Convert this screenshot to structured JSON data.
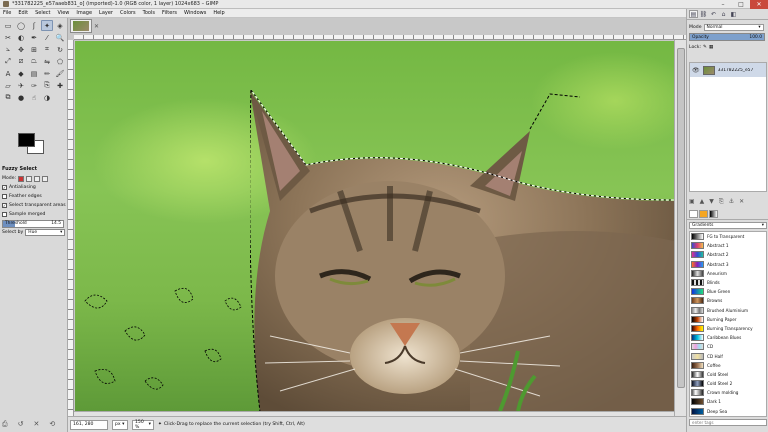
{
  "window": {
    "title": "*331782225_e57aaeb831_o] (imported)-1.0 (RGB color, 1 layer) 1024x683 – GIMP",
    "minimize": "–",
    "maximize": "□",
    "close": "✕"
  },
  "menu": [
    "File",
    "Edit",
    "Select",
    "View",
    "Image",
    "Layer",
    "Colors",
    "Tools",
    "Filters",
    "Windows",
    "Help"
  ],
  "toolbox": {
    "tools": [
      {
        "name": "rect-select-icon",
        "glyph": "▭"
      },
      {
        "name": "ellipse-select-icon",
        "glyph": "◯"
      },
      {
        "name": "free-select-icon",
        "glyph": "ʃ"
      },
      {
        "name": "fuzzy-select-icon",
        "glyph": "✦",
        "active": true
      },
      {
        "name": "color-select-icon",
        "glyph": "◈"
      },
      {
        "name": "scissors-icon",
        "glyph": "✂"
      },
      {
        "name": "foreground-select-icon",
        "glyph": "◐"
      },
      {
        "name": "paths-icon",
        "glyph": "✒"
      },
      {
        "name": "color-picker-icon",
        "glyph": "⁄"
      },
      {
        "name": "zoom-icon",
        "glyph": "🔍"
      },
      {
        "name": "measure-icon",
        "glyph": "⦣"
      },
      {
        "name": "move-icon",
        "glyph": "✥"
      },
      {
        "name": "align-icon",
        "glyph": "⊞"
      },
      {
        "name": "crop-icon",
        "glyph": "⌗"
      },
      {
        "name": "rotate-icon",
        "glyph": "↻"
      },
      {
        "name": "scale-icon",
        "glyph": "⤢"
      },
      {
        "name": "shear-icon",
        "glyph": "⧄"
      },
      {
        "name": "perspective-icon",
        "glyph": "⏢"
      },
      {
        "name": "flip-icon",
        "glyph": "⇋"
      },
      {
        "name": "cage-icon",
        "glyph": "⬠"
      },
      {
        "name": "text-icon",
        "glyph": "A"
      },
      {
        "name": "bucket-fill-icon",
        "glyph": "◆"
      },
      {
        "name": "blend-icon",
        "glyph": "▤"
      },
      {
        "name": "pencil-icon",
        "glyph": "✏"
      },
      {
        "name": "paintbrush-icon",
        "glyph": "🖌"
      },
      {
        "name": "eraser-icon",
        "glyph": "▱"
      },
      {
        "name": "airbrush-icon",
        "glyph": "✈"
      },
      {
        "name": "ink-icon",
        "glyph": "✑"
      },
      {
        "name": "clone-icon",
        "glyph": "⎘"
      },
      {
        "name": "heal-icon",
        "glyph": "✚"
      },
      {
        "name": "perspective-clone-icon",
        "glyph": "⧉"
      },
      {
        "name": "blur-icon",
        "glyph": "●"
      },
      {
        "name": "smudge-icon",
        "glyph": "☝"
      },
      {
        "name": "dodge-burn-icon",
        "glyph": "◑"
      }
    ],
    "options": {
      "title": "Fuzzy Select",
      "mode_label": "Mode:",
      "antialiasing": "Antialiasing",
      "feather_edges": "Feather edges",
      "select_transparent": "Select transparent areas",
      "sample_merged": "Sample merged",
      "threshold_label": "Threshold",
      "threshold_value": "14.5",
      "threshold_fraction": 0.2,
      "select_by_label": "Select by",
      "select_by_value": "Hue"
    },
    "bottom_glyphs": [
      "⎙",
      "↺",
      "✕",
      "⟲"
    ]
  },
  "canvas": {
    "image_tab_close": "✕"
  },
  "status": {
    "coords": "161, 280",
    "unit": "px",
    "zoom": "150 %",
    "message": "Click-Drag to replace the current selection (try Shift, Ctrl, Alt)"
  },
  "layers": {
    "mode_label": "Mode",
    "mode_value": "Normal",
    "opacity_label": "Opacity",
    "opacity_value": "100.0",
    "lock_label": "Lock:",
    "layer_name": "331782225_e57",
    "tabs": [
      "▤",
      "⛓",
      "↶",
      "⌂",
      "◧"
    ],
    "bottom_glyphs": [
      "▣",
      "▲",
      "▼",
      "⎘",
      "⚓",
      "✕"
    ]
  },
  "gradients": {
    "filter_label": "Gradients",
    "tag_placeholder": "enter tags",
    "items": [
      {
        "name": "FG to Transparent",
        "css": "linear-gradient(to right,#000,rgba(0,0,0,0))"
      },
      {
        "name": "Abstract 1",
        "css": "linear-gradient(to right,#3a4bd0,#e04070,#f0c050)"
      },
      {
        "name": "Abstract 2",
        "css": "linear-gradient(to right,#e03090,#3050d0,#20c0a0)"
      },
      {
        "name": "Abstract 3",
        "css": "linear-gradient(to right,#ff7020,#8020c0,#20a0f0)"
      },
      {
        "name": "Aneurism",
        "css": "linear-gradient(to right,#202020,#e0e0e0,#404040)"
      },
      {
        "name": "Blinds",
        "css": "repeating-linear-gradient(to right,#111 0,#111 2px,#ddd 2px,#ddd 4px)"
      },
      {
        "name": "Blue Green",
        "css": "linear-gradient(to right,#1030e0,#20e080)"
      },
      {
        "name": "Browns",
        "css": "linear-gradient(to right,#6b3b1a,#d09860,#4a2810)"
      },
      {
        "name": "Brushed Aluminium",
        "css": "linear-gradient(to right,#888,#eee,#777,#ddd)"
      },
      {
        "name": "Burning Paper",
        "css": "linear-gradient(to right,#000,#c04000,#fff)"
      },
      {
        "name": "Burning Transparency",
        "css": "linear-gradient(to right,#300,#f60,#ff0)"
      },
      {
        "name": "Caribbean Blues",
        "css": "linear-gradient(to right,#003080,#00c0e0,#fff)"
      },
      {
        "name": "CD",
        "css": "linear-gradient(to right,#ddd,#f0a0e0,#a0e0f0,#ddd)"
      },
      {
        "name": "CD Half",
        "css": "linear-gradient(to right,#ccc,#f0e0a0,#bbb)"
      },
      {
        "name": "Coffee",
        "css": "linear-gradient(to right,#3a2010,#9a7050,#f0e0c0)"
      },
      {
        "name": "Cold Steel",
        "css": "linear-gradient(to right,#222,#fff,#333)"
      },
      {
        "name": "Cold Steel 2",
        "css": "linear-gradient(to right,#0a1020,#90a0c0,#000)"
      },
      {
        "name": "Crown molding",
        "css": "linear-gradient(to right,#555,#fff,#999,#222)"
      },
      {
        "name": "Dark 1",
        "css": "linear-gradient(to right,#000,#705030)"
      },
      {
        "name": "Deep Sea",
        "css": "linear-gradient(to right,#001040,#0060a0)"
      }
    ]
  }
}
